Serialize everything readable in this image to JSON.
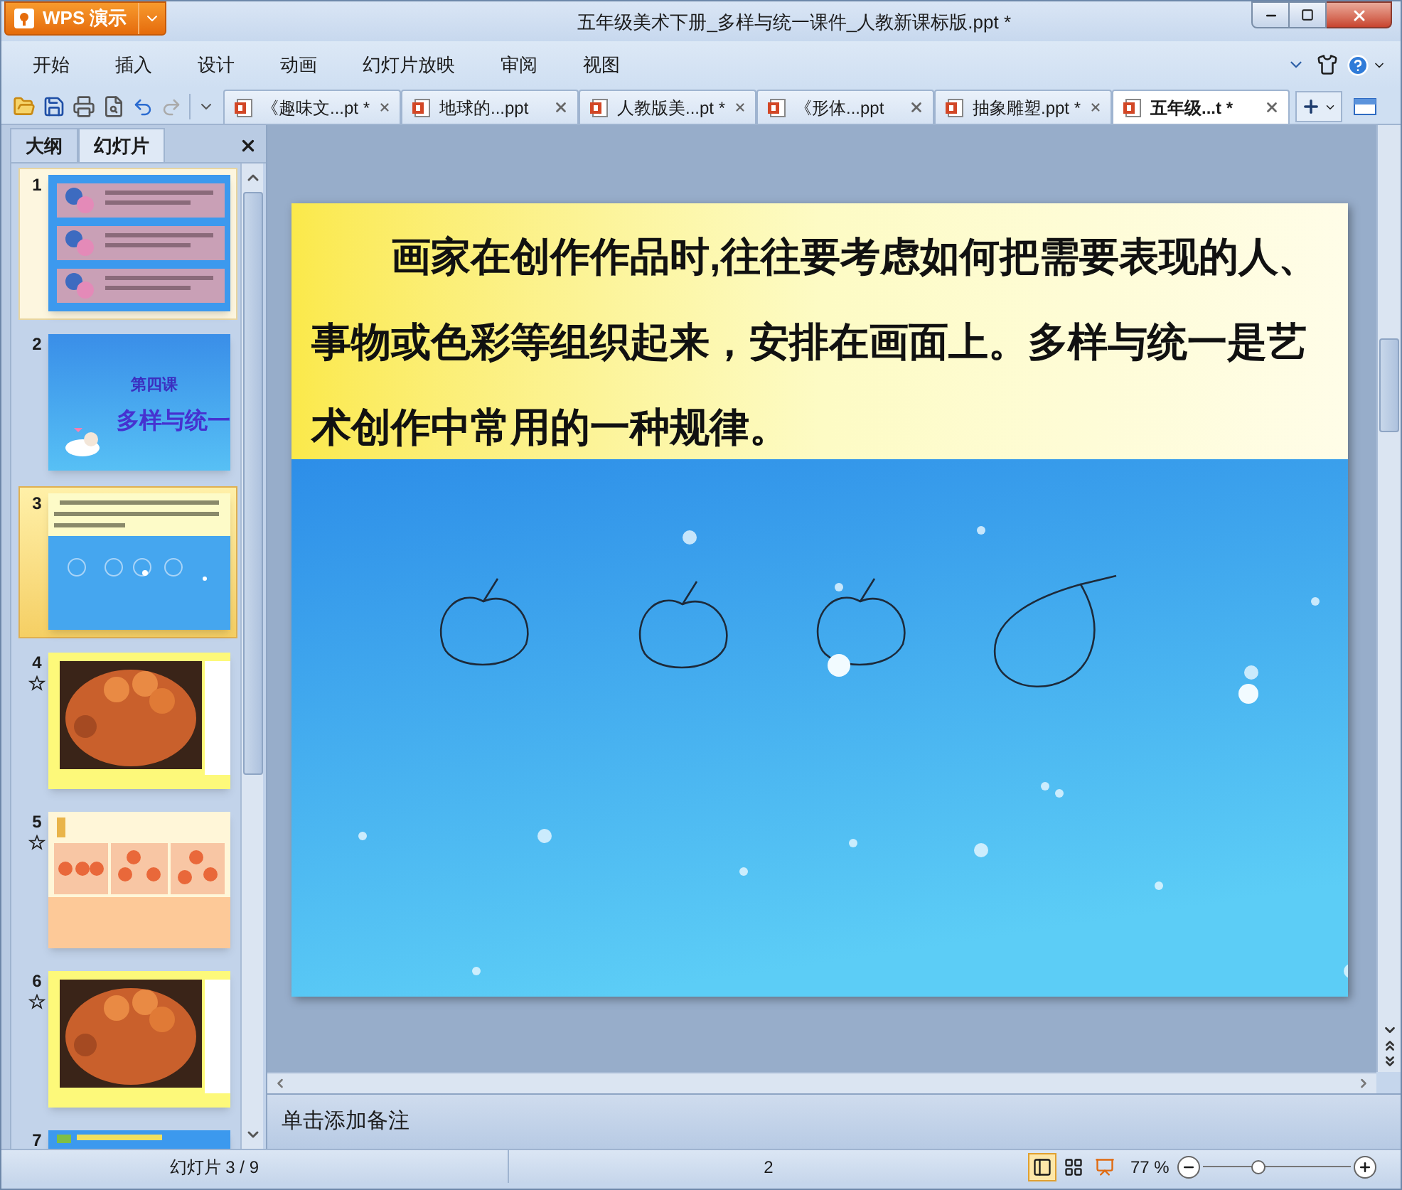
{
  "app": {
    "logo": "WPS 演示"
  },
  "window": {
    "title": "五年级美术下册_多样与统一课件_人教新课标版.ppt *"
  },
  "menu": [
    "开始",
    "插入",
    "设计",
    "动画",
    "幻灯片放映",
    "审阅",
    "视图"
  ],
  "doc_tabs": [
    {
      "label": "《趣味文...pt *",
      "selected": false
    },
    {
      "label": "地球的...ppt",
      "selected": false
    },
    {
      "label": "人教版美...pt *",
      "selected": false
    },
    {
      "label": "《形体...ppt",
      "selected": false
    },
    {
      "label": "抽象雕塑.ppt *",
      "selected": false
    },
    {
      "label": "五年级...t *",
      "selected": true
    }
  ],
  "panel": {
    "tabs": [
      {
        "label": "大纲",
        "selected": false
      },
      {
        "label": "幻灯片",
        "selected": true
      }
    ]
  },
  "slides": [
    {
      "number": "1",
      "kind": "flowers",
      "selected": false,
      "hovered": true,
      "animated": false
    },
    {
      "number": "2",
      "kind": "title",
      "selected": false,
      "hovered": false,
      "animated": false,
      "texts": [
        "第四课",
        "多样与统一"
      ]
    },
    {
      "number": "3",
      "kind": "current",
      "selected": true,
      "hovered": false,
      "animated": false
    },
    {
      "number": "4",
      "kind": "painting",
      "selected": false,
      "hovered": false,
      "animated": true
    },
    {
      "number": "5",
      "kind": "fruits",
      "selected": false,
      "hovered": false,
      "animated": true
    },
    {
      "number": "6",
      "kind": "painting",
      "selected": false,
      "hovered": false,
      "animated": true
    },
    {
      "number": "7",
      "kind": "banner",
      "selected": false,
      "hovered": false,
      "animated": false
    }
  ],
  "current_slide": {
    "text": "画家在创作作品时,往往要考虑如何把需要表现的人、事物或色彩等组织起来，安排在画面上。多样与统一是艺术创作中常用的一种规律。"
  },
  "notes": {
    "placeholder": "单击添加备注"
  },
  "status_bar": {
    "slide_counter": "幻灯片 3 / 9",
    "center": "2",
    "zoom": "77 %",
    "zoom_slider": {
      "level": 0.37
    }
  }
}
